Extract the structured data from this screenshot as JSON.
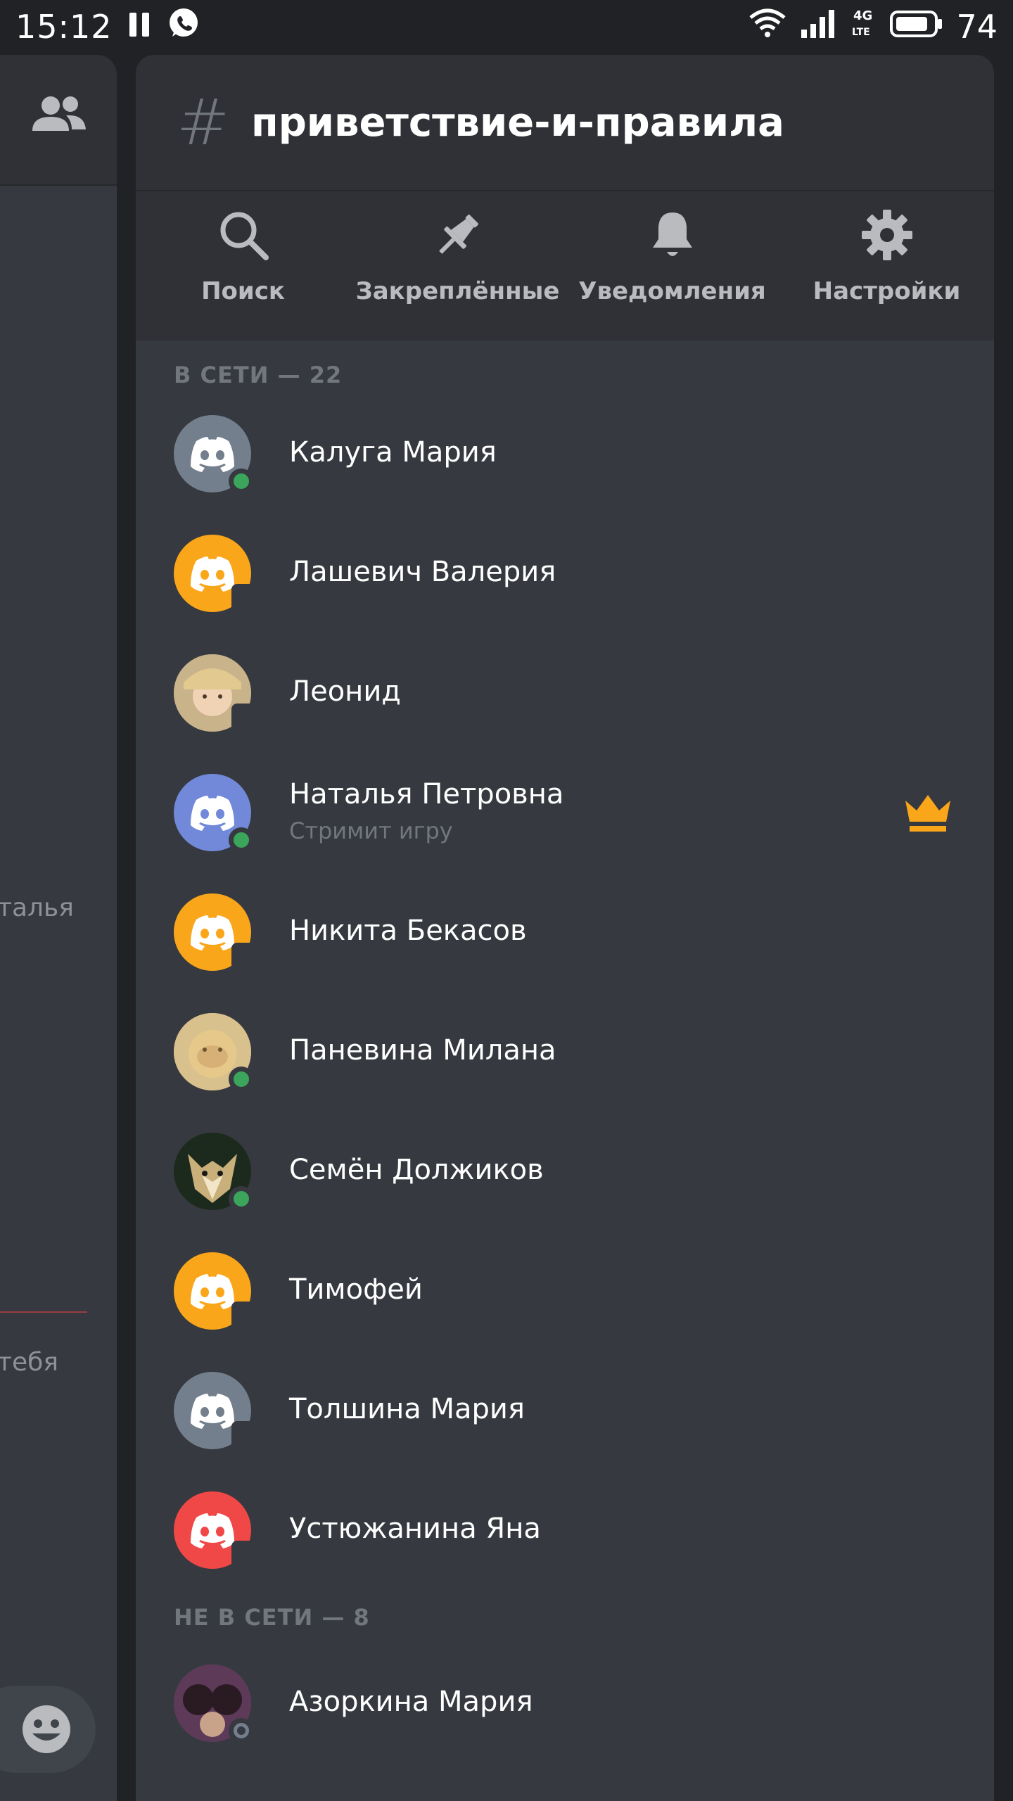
{
  "status_bar": {
    "time": "15:12",
    "battery": "74",
    "network": "4G LTE"
  },
  "background": {
    "fragment_1": "талья",
    "fragment_2": "тебя"
  },
  "channel": {
    "hash": "#",
    "name": "приветствие-и-правила"
  },
  "actions": [
    {
      "label": "Поиск",
      "icon": "search-icon"
    },
    {
      "label": "Закреплённые",
      "icon": "pin-icon"
    },
    {
      "label": "Уведомления",
      "icon": "bell-icon"
    },
    {
      "label": "Настройки",
      "icon": "gear-icon"
    }
  ],
  "online_section": {
    "label": "В СЕТИ — 22"
  },
  "offline_section": {
    "label": "НЕ В СЕТИ — 8"
  },
  "members": [
    {
      "name": "Калуга Мария",
      "avatar_color": "#747f8d",
      "status": "online"
    },
    {
      "name": "Лашевич Валерия",
      "avatar_color": "#faa61a",
      "status": "mobile"
    },
    {
      "name": "Леонид",
      "avatar_color": "#c9b38a",
      "status": "mobile",
      "photo": true
    },
    {
      "name": "Наталья Петровна",
      "sub": "Стримит игру",
      "avatar_color": "#7289da",
      "status": "online",
      "owner": true
    },
    {
      "name": "Никита Бекасов",
      "avatar_color": "#faa61a",
      "status": "mobile"
    },
    {
      "name": "Паневина Милана",
      "avatar_color": "#d9c18d",
      "status": "online",
      "photo": true
    },
    {
      "name": "Семён Должиков",
      "avatar_color": "#3a3a2a",
      "status": "online",
      "photo": true
    },
    {
      "name": "Тимофей",
      "avatar_color": "#faa61a",
      "status": "mobile"
    },
    {
      "name": "Толшина Мария",
      "avatar_color": "#747f8d",
      "status": "mobile"
    },
    {
      "name": "Устюжанина Яна",
      "avatar_color": "#f04747",
      "status": "mobile"
    }
  ],
  "offline_members": [
    {
      "name": "Азоркина Мария",
      "avatar_color": "#6b4a6e",
      "status": "offline",
      "photo": true
    }
  ],
  "colors": {
    "online": "#3ba55c",
    "crown": "#faa61a",
    "offline": "#747f8d"
  }
}
